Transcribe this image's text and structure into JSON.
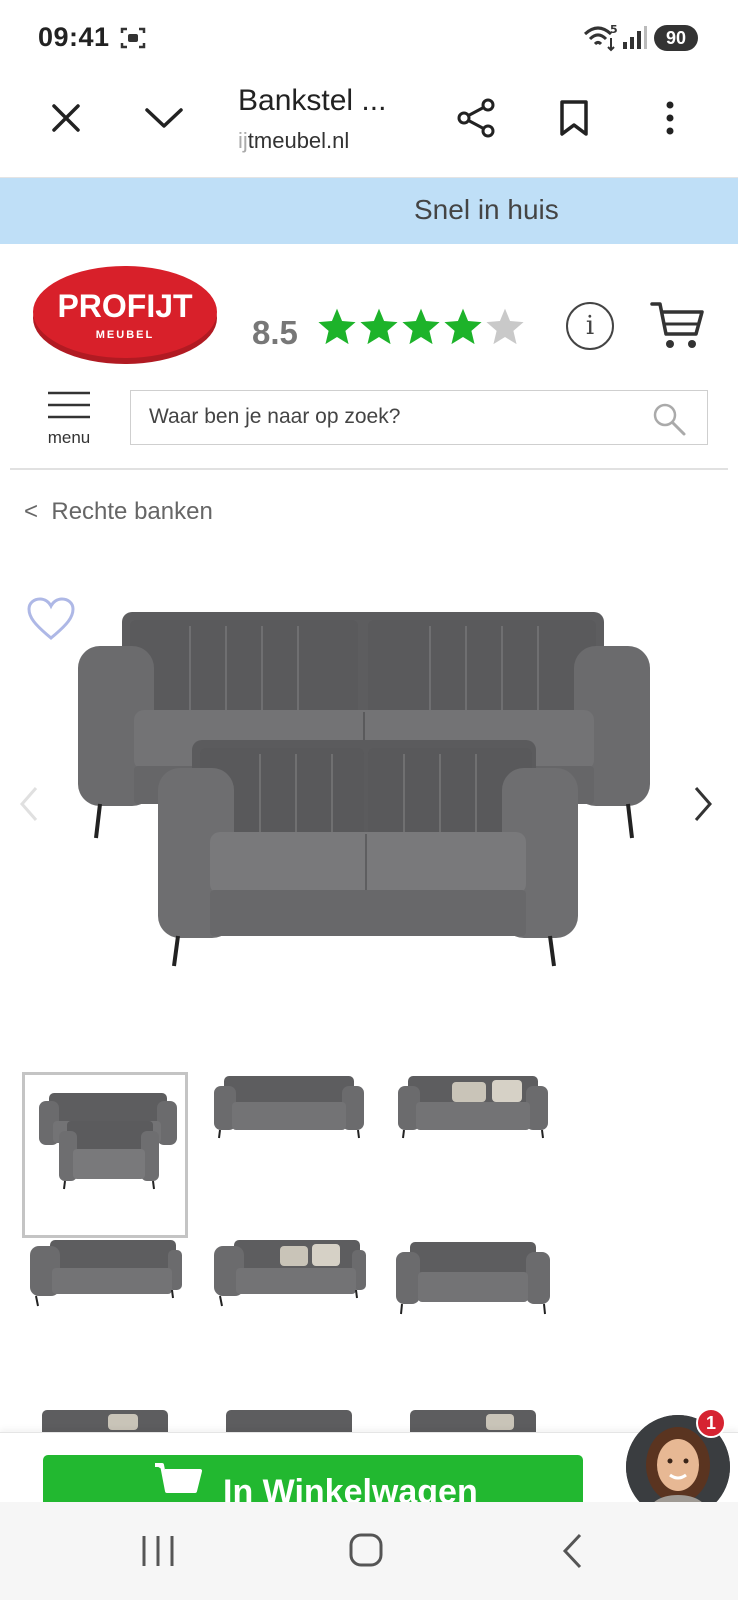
{
  "status_bar": {
    "time": "09:41",
    "battery": "90",
    "network_badge": "5"
  },
  "browser": {
    "page_title": "Bankstel ...",
    "domain_faded": "ij",
    "domain": "tmeubel.nl"
  },
  "promo_banner": {
    "text": "Snel in huis"
  },
  "site_header": {
    "logo_text": "PROFIJT",
    "logo_subtext": "MEUBEL",
    "rating_score": "8.5",
    "stars_filled": 4,
    "stars_total": 5,
    "menu_label": "menu",
    "search_placeholder": "Waar ben je naar op zoek?"
  },
  "breadcrumb": {
    "arrow": "<",
    "label": "Rechte banken"
  },
  "action_bar": {
    "add_to_cart_label": "In Winkelwagen",
    "chat_badge_count": "1"
  },
  "colors": {
    "accent_green": "#22b830",
    "star_green": "#1db32a",
    "logo_red": "#d8202a",
    "banner_blue": "#bfdff7",
    "sofa_grey": "#6b6b6d"
  }
}
